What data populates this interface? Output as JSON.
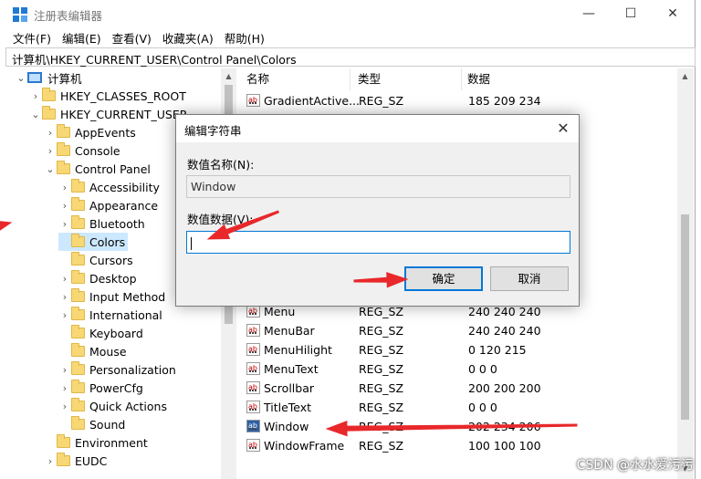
{
  "window": {
    "title": "注册表编辑器",
    "minimize_glyph": "—",
    "maximize_glyph": "☐",
    "close_glyph": "✕"
  },
  "menu": [
    "文件(F)",
    "编辑(E)",
    "查看(V)",
    "收藏夹(A)",
    "帮助(H)"
  ],
  "address": "计算机\\HKEY_CURRENT_USER\\Control Panel\\Colors",
  "tree": [
    {
      "label": "计算机",
      "level": 0,
      "chevron": "∨",
      "kind": "pc"
    },
    {
      "label": "HKEY_CLASSES_ROOT",
      "level": 1,
      "chevron": ">",
      "kind": "folder"
    },
    {
      "label": "HKEY_CURRENT_USER",
      "level": 1,
      "chevron": "∨",
      "kind": "folder"
    },
    {
      "label": "AppEvents",
      "level": 2,
      "chevron": ">",
      "kind": "folder"
    },
    {
      "label": "Console",
      "level": 2,
      "chevron": ">",
      "kind": "folder"
    },
    {
      "label": "Control Panel",
      "level": 2,
      "chevron": "∨",
      "kind": "folder"
    },
    {
      "label": "Accessibility",
      "level": 3,
      "chevron": ">",
      "kind": "folder"
    },
    {
      "label": "Appearance",
      "level": 3,
      "chevron": ">",
      "kind": "folder"
    },
    {
      "label": "Bluetooth",
      "level": 3,
      "chevron": ">",
      "kind": "folder"
    },
    {
      "label": "Colors",
      "level": 3,
      "chevron": "",
      "kind": "folder",
      "selected": true
    },
    {
      "label": "Cursors",
      "level": 3,
      "chevron": "",
      "kind": "folder"
    },
    {
      "label": "Desktop",
      "level": 3,
      "chevron": ">",
      "kind": "folder"
    },
    {
      "label": "Input Method",
      "level": 3,
      "chevron": ">",
      "kind": "folder"
    },
    {
      "label": "International",
      "level": 3,
      "chevron": ">",
      "kind": "folder"
    },
    {
      "label": "Keyboard",
      "level": 3,
      "chevron": "",
      "kind": "folder"
    },
    {
      "label": "Mouse",
      "level": 3,
      "chevron": "",
      "kind": "folder"
    },
    {
      "label": "Personalization",
      "level": 3,
      "chevron": ">",
      "kind": "folder"
    },
    {
      "label": "PowerCfg",
      "level": 3,
      "chevron": ">",
      "kind": "folder"
    },
    {
      "label": "Quick Actions",
      "level": 3,
      "chevron": ">",
      "kind": "folder"
    },
    {
      "label": "Sound",
      "level": 3,
      "chevron": "",
      "kind": "folder"
    },
    {
      "label": "Environment",
      "level": 2,
      "chevron": "",
      "kind": "folder"
    },
    {
      "label": "EUDC",
      "level": 2,
      "chevron": ">",
      "kind": "folder"
    }
  ],
  "list": {
    "headers": [
      "名称",
      "类型",
      "数据"
    ],
    "rows": [
      {
        "name": "GradientActive...",
        "type": "REG_SZ",
        "data": "185 209 234",
        "slot": 0
      },
      {
        "name": "Menu",
        "type": "REG_SZ",
        "data": "240 240 240",
        "slot": 11
      },
      {
        "name": "MenuBar",
        "type": "REG_SZ",
        "data": "240 240 240",
        "slot": 12
      },
      {
        "name": "MenuHilight",
        "type": "REG_SZ",
        "data": "0 120 215",
        "slot": 13
      },
      {
        "name": "MenuText",
        "type": "REG_SZ",
        "data": "0 0 0",
        "slot": 14
      },
      {
        "name": "Scrollbar",
        "type": "REG_SZ",
        "data": "200 200 200",
        "slot": 15
      },
      {
        "name": "TitleText",
        "type": "REG_SZ",
        "data": "0 0 0",
        "slot": 16
      },
      {
        "name": "Window",
        "type": "REG_SZ",
        "data": "202 234 206",
        "slot": 17,
        "selected": true
      },
      {
        "name": "WindowFrame",
        "type": "REG_SZ",
        "data": "100 100 100",
        "slot": 18
      }
    ]
  },
  "dialog": {
    "title": "编辑字符串",
    "name_label": "数值名称(N):",
    "name_value": "Window",
    "data_label": "数值数据(V):",
    "data_value": "",
    "ok_label": "确定",
    "cancel_label": "取消",
    "close_glyph": "✕"
  },
  "watermark": "CSDN @水水爱污污",
  "colors": {
    "arrow": "#e8282b",
    "selection": "#cce8ff",
    "accent": "#0078d7"
  }
}
